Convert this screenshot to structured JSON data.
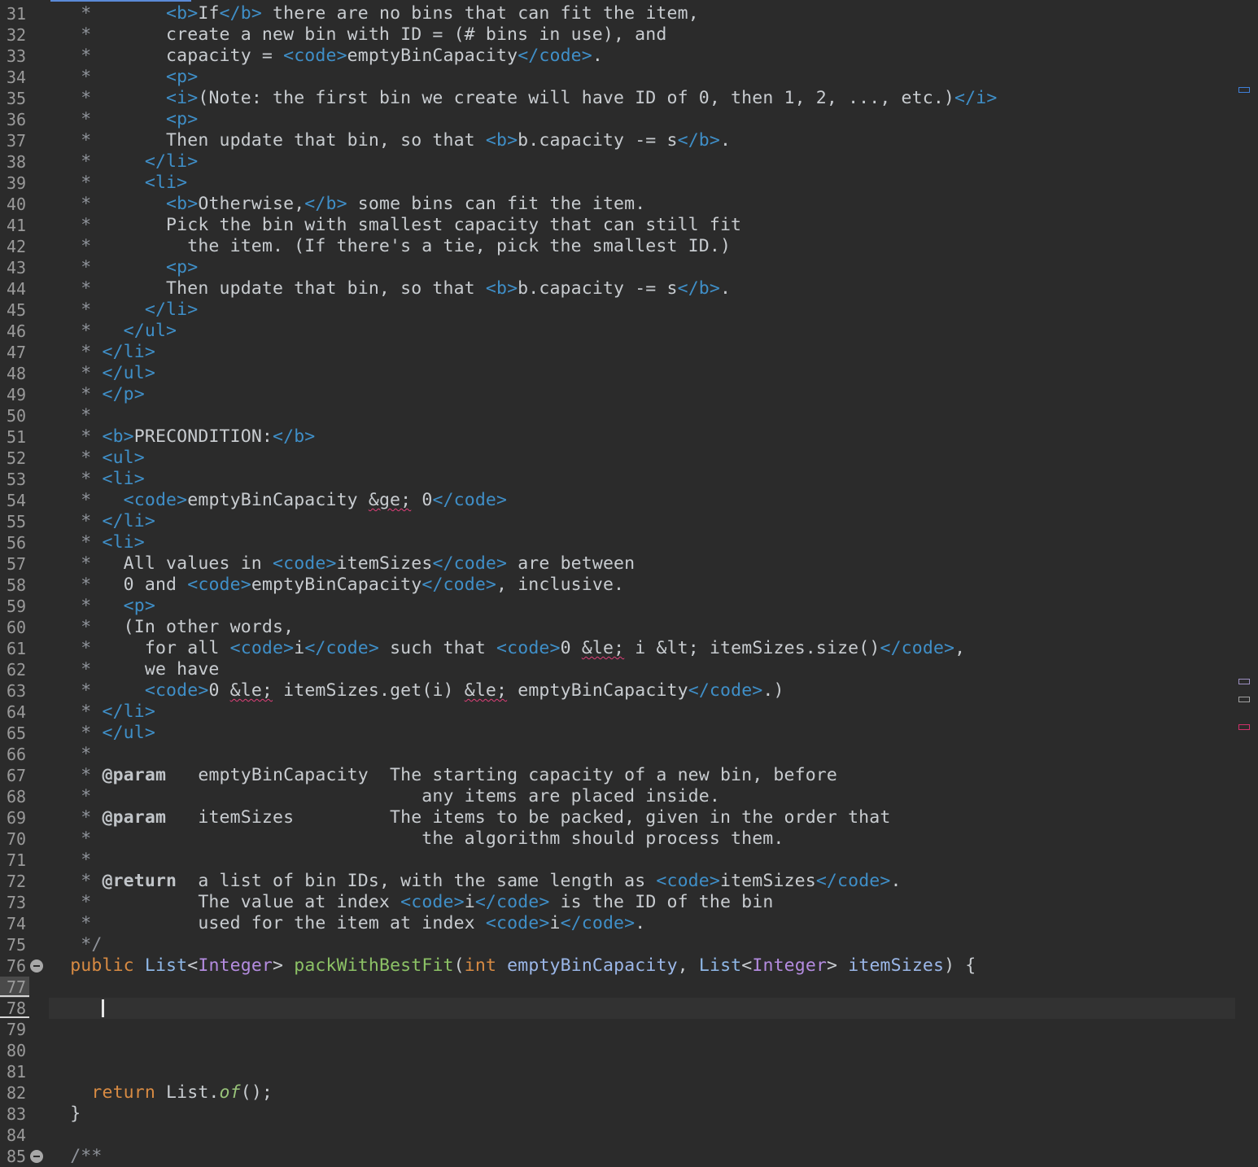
{
  "editor": {
    "lines": [
      {
        "n": "31",
        "segs": [
          [
            "g",
            "   *       "
          ],
          [
            "tag",
            "<b>"
          ],
          [
            "t",
            "If"
          ],
          [
            "tag",
            "</b>"
          ],
          [
            "t",
            " there are no bins that can fit the item,"
          ]
        ]
      },
      {
        "n": "32",
        "segs": [
          [
            "g",
            "   *       "
          ],
          [
            "t",
            "create a new bin with ID = (# bins in use), and"
          ]
        ]
      },
      {
        "n": "33",
        "segs": [
          [
            "g",
            "   *       "
          ],
          [
            "t",
            "capacity = "
          ],
          [
            "tag",
            "<code>"
          ],
          [
            "t",
            "emptyBinCapacity"
          ],
          [
            "tag",
            "</code>"
          ],
          [
            "t",
            "."
          ]
        ]
      },
      {
        "n": "34",
        "segs": [
          [
            "g",
            "   *       "
          ],
          [
            "tag",
            "<p>"
          ]
        ]
      },
      {
        "n": "35",
        "segs": [
          [
            "g",
            "   *       "
          ],
          [
            "tag",
            "<i>"
          ],
          [
            "t",
            "(Note: the first bin we create will have ID of 0, then 1, 2, ..., etc.)"
          ],
          [
            "tag",
            "</i>"
          ]
        ]
      },
      {
        "n": "36",
        "segs": [
          [
            "g",
            "   *       "
          ],
          [
            "tag",
            "<p>"
          ]
        ]
      },
      {
        "n": "37",
        "segs": [
          [
            "g",
            "   *       "
          ],
          [
            "t",
            "Then update that bin, so that "
          ],
          [
            "tag",
            "<b>"
          ],
          [
            "t",
            "b.capacity -= s"
          ],
          [
            "tag",
            "</b>"
          ],
          [
            "t",
            "."
          ]
        ]
      },
      {
        "n": "38",
        "segs": [
          [
            "g",
            "   *     "
          ],
          [
            "tag",
            "</li>"
          ]
        ]
      },
      {
        "n": "39",
        "segs": [
          [
            "g",
            "   *     "
          ],
          [
            "tag",
            "<li>"
          ]
        ]
      },
      {
        "n": "40",
        "segs": [
          [
            "g",
            "   *       "
          ],
          [
            "tag",
            "<b>"
          ],
          [
            "t",
            "Otherwise,"
          ],
          [
            "tag",
            "</b>"
          ],
          [
            "t",
            " some bins can fit the item."
          ]
        ]
      },
      {
        "n": "41",
        "segs": [
          [
            "g",
            "   *       "
          ],
          [
            "t",
            "Pick the bin with smallest capacity that can still fit"
          ]
        ]
      },
      {
        "n": "42",
        "segs": [
          [
            "g",
            "   *         "
          ],
          [
            "t",
            "the item. (If there's a tie, pick the smallest ID.)"
          ]
        ]
      },
      {
        "n": "43",
        "segs": [
          [
            "g",
            "   *       "
          ],
          [
            "tag",
            "<p>"
          ]
        ]
      },
      {
        "n": "44",
        "segs": [
          [
            "g",
            "   *       "
          ],
          [
            "t",
            "Then update that bin, so that "
          ],
          [
            "tag",
            "<b>"
          ],
          [
            "t",
            "b.capacity -= s"
          ],
          [
            "tag",
            "</b>"
          ],
          [
            "t",
            "."
          ]
        ]
      },
      {
        "n": "45",
        "segs": [
          [
            "g",
            "   *     "
          ],
          [
            "tag",
            "</li>"
          ]
        ]
      },
      {
        "n": "46",
        "segs": [
          [
            "g",
            "   *   "
          ],
          [
            "tag",
            "</ul>"
          ]
        ]
      },
      {
        "n": "47",
        "segs": [
          [
            "g",
            "   * "
          ],
          [
            "tag",
            "</li>"
          ]
        ]
      },
      {
        "n": "48",
        "segs": [
          [
            "g",
            "   * "
          ],
          [
            "tag",
            "</ul>"
          ]
        ]
      },
      {
        "n": "49",
        "segs": [
          [
            "g",
            "   * "
          ],
          [
            "tag",
            "</p>"
          ]
        ]
      },
      {
        "n": "50",
        "segs": [
          [
            "g",
            "   *"
          ]
        ]
      },
      {
        "n": "51",
        "segs": [
          [
            "g",
            "   * "
          ],
          [
            "tag",
            "<b>"
          ],
          [
            "t",
            "PRECONDITION:"
          ],
          [
            "tag",
            "</b>"
          ]
        ]
      },
      {
        "n": "52",
        "segs": [
          [
            "g",
            "   * "
          ],
          [
            "tag",
            "<ul>"
          ]
        ]
      },
      {
        "n": "53",
        "segs": [
          [
            "g",
            "   * "
          ],
          [
            "tag",
            "<li>"
          ]
        ]
      },
      {
        "n": "54",
        "segs": [
          [
            "g",
            "   *   "
          ],
          [
            "tag",
            "<code>"
          ],
          [
            "t",
            "emptyBinCapacity "
          ],
          [
            "sq",
            "&ge;"
          ],
          [
            "t",
            " 0"
          ],
          [
            "tag",
            "</code>"
          ]
        ]
      },
      {
        "n": "55",
        "segs": [
          [
            "g",
            "   * "
          ],
          [
            "tag",
            "</li>"
          ]
        ]
      },
      {
        "n": "56",
        "segs": [
          [
            "g",
            "   * "
          ],
          [
            "tag",
            "<li>"
          ]
        ]
      },
      {
        "n": "57",
        "segs": [
          [
            "g",
            "   *   "
          ],
          [
            "t",
            "All values in "
          ],
          [
            "tag",
            "<code>"
          ],
          [
            "t",
            "itemSizes"
          ],
          [
            "tag",
            "</code>"
          ],
          [
            "t",
            " are between"
          ]
        ]
      },
      {
        "n": "58",
        "segs": [
          [
            "g",
            "   *   "
          ],
          [
            "t",
            "0 and "
          ],
          [
            "tag",
            "<code>"
          ],
          [
            "t",
            "emptyBinCapacity"
          ],
          [
            "tag",
            "</code>"
          ],
          [
            "t",
            ", inclusive."
          ]
        ]
      },
      {
        "n": "59",
        "segs": [
          [
            "g",
            "   *   "
          ],
          [
            "tag",
            "<p>"
          ]
        ]
      },
      {
        "n": "60",
        "segs": [
          [
            "g",
            "   *   "
          ],
          [
            "t",
            "(In other words,"
          ]
        ]
      },
      {
        "n": "61",
        "segs": [
          [
            "g",
            "   *     "
          ],
          [
            "t",
            "for all "
          ],
          [
            "tag",
            "<code>"
          ],
          [
            "t",
            "i"
          ],
          [
            "tag",
            "</code>"
          ],
          [
            "t",
            " such that "
          ],
          [
            "tag",
            "<code>"
          ],
          [
            "t",
            "0 "
          ],
          [
            "sq",
            "&le;"
          ],
          [
            "t",
            " i &lt; itemSizes.size()"
          ],
          [
            "tag",
            "</code>"
          ],
          [
            "t",
            ","
          ]
        ]
      },
      {
        "n": "62",
        "segs": [
          [
            "g",
            "   *     "
          ],
          [
            "t",
            "we have"
          ]
        ]
      },
      {
        "n": "63",
        "segs": [
          [
            "g",
            "   *     "
          ],
          [
            "tag",
            "<code>"
          ],
          [
            "t",
            "0 "
          ],
          [
            "sq",
            "&le;"
          ],
          [
            "t",
            " itemSizes.get(i) "
          ],
          [
            "sq",
            "&le;"
          ],
          [
            "t",
            " emptyBinCapacity"
          ],
          [
            "tag",
            "</code>"
          ],
          [
            "t",
            ".)"
          ]
        ]
      },
      {
        "n": "64",
        "segs": [
          [
            "g",
            "   * "
          ],
          [
            "tag",
            "</li>"
          ]
        ]
      },
      {
        "n": "65",
        "segs": [
          [
            "g",
            "   * "
          ],
          [
            "tag",
            "</ul>"
          ]
        ]
      },
      {
        "n": "66",
        "segs": [
          [
            "g",
            "   *"
          ]
        ]
      },
      {
        "n": "67",
        "segs": [
          [
            "g",
            "   * "
          ],
          [
            "at",
            "@param"
          ],
          [
            "t",
            "   emptyBinCapacity  The starting capacity of a new bin, before"
          ]
        ]
      },
      {
        "n": "68",
        "segs": [
          [
            "g",
            "   *                               "
          ],
          [
            "t",
            "any items are placed inside."
          ]
        ]
      },
      {
        "n": "69",
        "segs": [
          [
            "g",
            "   * "
          ],
          [
            "at",
            "@param"
          ],
          [
            "t",
            "   itemSizes         The items to be packed, given in the order that"
          ]
        ]
      },
      {
        "n": "70",
        "segs": [
          [
            "g",
            "   *                               "
          ],
          [
            "t",
            "the algorithm should process them."
          ]
        ]
      },
      {
        "n": "71",
        "segs": [
          [
            "g",
            "   *"
          ]
        ]
      },
      {
        "n": "72",
        "segs": [
          [
            "g",
            "   * "
          ],
          [
            "at",
            "@return"
          ],
          [
            "t",
            "  a list of bin IDs, with the same length as "
          ],
          [
            "tag",
            "<code>"
          ],
          [
            "t",
            "itemSizes"
          ],
          [
            "tag",
            "</code>"
          ],
          [
            "t",
            "."
          ]
        ]
      },
      {
        "n": "73",
        "segs": [
          [
            "g",
            "   *          "
          ],
          [
            "t",
            "The value at index "
          ],
          [
            "tag",
            "<code>"
          ],
          [
            "t",
            "i"
          ],
          [
            "tag",
            "</code>"
          ],
          [
            "t",
            " is the ID of the bin"
          ]
        ]
      },
      {
        "n": "74",
        "segs": [
          [
            "g",
            "   *          "
          ],
          [
            "t",
            "used for the item at index "
          ],
          [
            "tag",
            "<code>"
          ],
          [
            "t",
            "i"
          ],
          [
            "tag",
            "</code>"
          ],
          [
            "t",
            "."
          ]
        ]
      },
      {
        "n": "75",
        "segs": [
          [
            "g",
            "   */"
          ]
        ]
      },
      {
        "n": "76",
        "fold": true,
        "segs": [
          [
            "kw",
            "  public "
          ],
          [
            "ty",
            "List"
          ],
          [
            "t",
            "<"
          ],
          [
            "gen",
            "Integer"
          ],
          [
            "t",
            "> "
          ],
          [
            "fn",
            "packWithBestFit"
          ],
          [
            "t",
            "("
          ],
          [
            "kw",
            "int "
          ],
          [
            "par",
            "emptyBinCapacity"
          ],
          [
            "t",
            ", "
          ],
          [
            "ty",
            "List"
          ],
          [
            "t",
            "<"
          ],
          [
            "gen",
            "Integer"
          ],
          [
            "t",
            "> "
          ],
          [
            "par",
            "itemSizes"
          ],
          [
            "t",
            ") {"
          ]
        ]
      },
      {
        "n": "77",
        "segs": []
      },
      {
        "n": "78",
        "segs": []
      },
      {
        "n": "79",
        "segs": []
      },
      {
        "n": "80",
        "segs": []
      },
      {
        "n": "81",
        "segs": []
      },
      {
        "n": "82",
        "segs": [
          [
            "kw",
            "    return "
          ],
          [
            "t",
            "List."
          ],
          [
            "st",
            "of"
          ],
          [
            "t",
            "();"
          ]
        ]
      },
      {
        "n": "83",
        "segs": [
          [
            "t",
            "  }"
          ]
        ]
      },
      {
        "n": "84",
        "segs": []
      },
      {
        "n": "85",
        "fold": true,
        "segs": [
          [
            "g",
            "  /**"
          ]
        ]
      }
    ]
  },
  "scrollbar_markers": [
    {
      "name": "blue-marker",
      "color": "#3f7fd8"
    },
    {
      "name": "purple-marker",
      "color": "#9c8fc0"
    },
    {
      "name": "gray-marker",
      "color": "#a0a0a0"
    },
    {
      "name": "red-marker",
      "color": "#d0306a"
    }
  ]
}
